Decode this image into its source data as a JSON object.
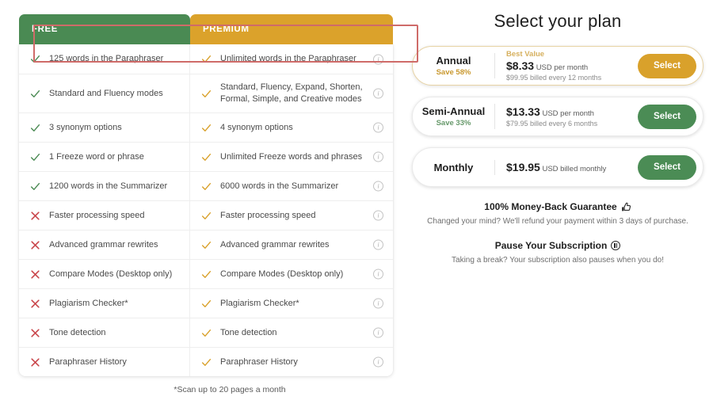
{
  "comparison": {
    "tabs": [
      {
        "label": "FREE",
        "color": "#4A8A53"
      },
      {
        "label": "PREMIUM",
        "color": "#DBA22B"
      }
    ],
    "rows": [
      {
        "free_mark": "check",
        "free_label": "125 words in the Paraphraser",
        "prem_mark": "check",
        "prem_label": "Unlimited words in the Paraphraser",
        "info": "i"
      },
      {
        "free_mark": "check",
        "free_label": "Standard and Fluency modes",
        "prem_mark": "check",
        "prem_label": "Standard, Fluency, Expand, Shorten, Formal, Simple, and Creative modes",
        "info": "i"
      },
      {
        "free_mark": "check",
        "free_label": "3 synonym options",
        "prem_mark": "check",
        "prem_label": "4 synonym options",
        "info": "i"
      },
      {
        "free_mark": "check",
        "free_label": "1 Freeze word or phrase",
        "prem_mark": "check",
        "prem_label": "Unlimited Freeze words and phrases",
        "info": "i"
      },
      {
        "free_mark": "check",
        "free_label": "1200 words in the Summarizer",
        "prem_mark": "check",
        "prem_label": "6000 words in the Summarizer",
        "info": "i"
      },
      {
        "free_mark": "cross",
        "free_label": "Faster processing speed",
        "prem_mark": "check",
        "prem_label": "Faster processing speed",
        "info": "i"
      },
      {
        "free_mark": "cross",
        "free_label": "Advanced grammar rewrites",
        "prem_mark": "check",
        "prem_label": "Advanced grammar rewrites",
        "info": "i"
      },
      {
        "free_mark": "cross",
        "free_label": "Compare Modes (Desktop only)",
        "prem_mark": "check",
        "prem_label": "Compare Modes (Desktop only)",
        "info": "i"
      },
      {
        "free_mark": "cross",
        "free_label": "Plagiarism Checker*",
        "prem_mark": "check",
        "prem_label": "Plagiarism Checker*",
        "info": "i"
      },
      {
        "free_mark": "cross",
        "free_label": "Tone detection",
        "prem_mark": "check",
        "prem_label": "Tone detection",
        "info": "i"
      },
      {
        "free_mark": "cross",
        "free_label": "Paraphraser History",
        "prem_mark": "check",
        "prem_label": "Paraphraser History",
        "info": "i"
      }
    ],
    "footnote": "*Scan up to 20 pages a month",
    "check_color_free": "#4A8A53",
    "check_color_premium": "#D9A12B",
    "cross_color": "#C9454A"
  },
  "plans": {
    "title": "Select your plan",
    "items": [
      {
        "name": "Annual",
        "save": "Save 58%",
        "badge": "Best Value",
        "price": "$8.33",
        "price_unit": "USD per month",
        "billing": "$99.95 billed every 12 months",
        "button": "Select",
        "button_color": "#D9A12B"
      },
      {
        "name": "Semi-Annual",
        "save": "Save 33%",
        "badge": "",
        "price": "$13.33",
        "price_unit": "USD per month",
        "billing": "$79.95 billed every 6 months",
        "button": "Select",
        "button_color": "#4B8C55"
      },
      {
        "name": "Monthly",
        "save": "",
        "badge": "",
        "price": "$19.95",
        "price_unit": "USD billed monthly",
        "billing": "",
        "button": "Select",
        "button_color": "#4B8C55"
      }
    ],
    "guarantee": {
      "heading": "100% Money-Back Guarantee",
      "subtext": "Changed your mind? We'll refund your payment within 3 days of purchase."
    },
    "pause": {
      "heading": "Pause Your Subscription",
      "subtext": "Taking a break? Your subscription also pauses when you do!"
    }
  }
}
